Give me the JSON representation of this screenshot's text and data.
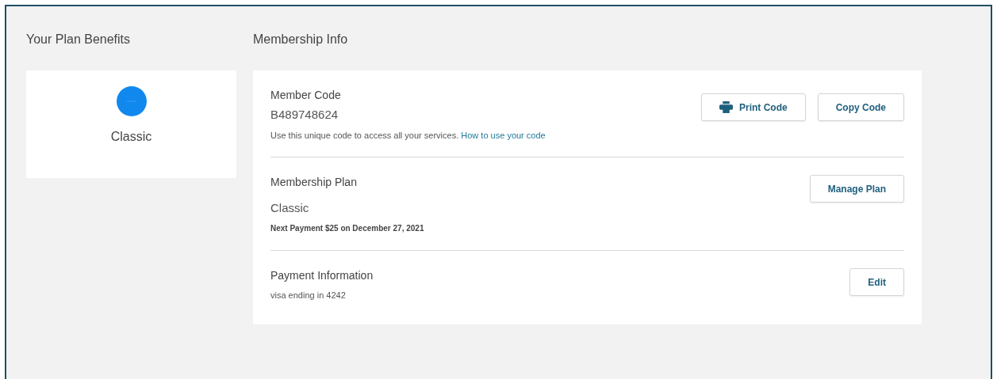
{
  "benefits": {
    "title": "Your Plan Benefits",
    "plan": "Classic"
  },
  "membership": {
    "title": "Membership Info",
    "sections": [
      {
        "label": "Member Code",
        "value": "B489748624",
        "description": "Use this unique code to access all your services.",
        "link": "How to use your code",
        "buttons": [
          {
            "label": "Print Code",
            "kind": "print"
          },
          {
            "label": "Copy Code",
            "kind": "plain"
          }
        ]
      },
      {
        "label": "Membership Plan",
        "value": "Classic",
        "note": "Next Payment $25 on December 27, 2021",
        "buttons": [
          {
            "label": "Manage Plan",
            "kind": "plain"
          }
        ]
      },
      {
        "label": "Payment Information",
        "description": "visa ending in 4242",
        "buttons": [
          {
            "label": "Edit",
            "kind": "plain"
          }
        ]
      }
    ]
  }
}
